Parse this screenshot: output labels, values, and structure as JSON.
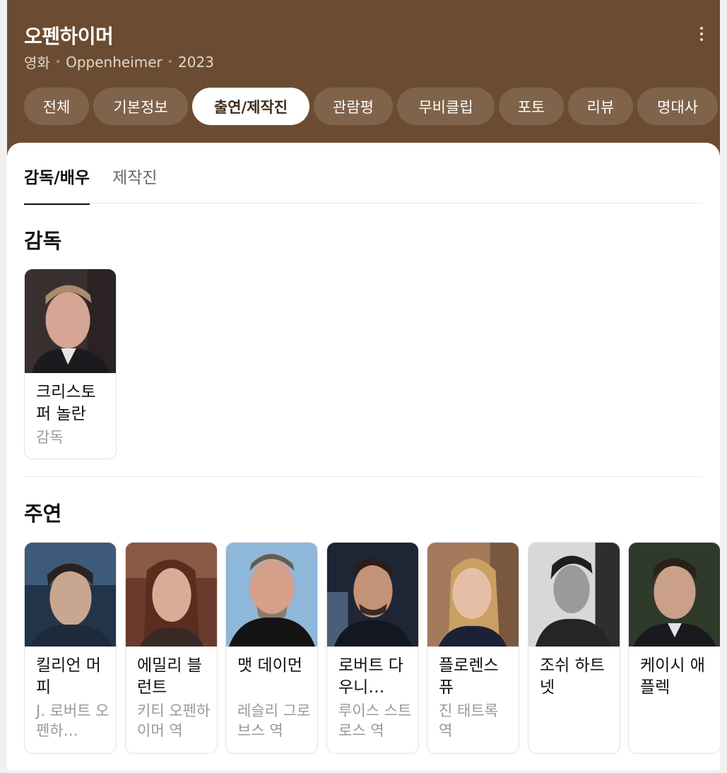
{
  "header": {
    "title": "오펜하이머",
    "subtitle": {
      "category": "영화",
      "original_title": "Oppenheimer",
      "year": "2023"
    },
    "more_icon": "vertical-ellipsis-icon"
  },
  "tabs": [
    {
      "label": "전체"
    },
    {
      "label": "기본정보"
    },
    {
      "label": "출연/제작진",
      "active": true
    },
    {
      "label": "관람평"
    },
    {
      "label": "무비클립"
    },
    {
      "label": "포토"
    },
    {
      "label": "리뷰"
    },
    {
      "label": "명대사"
    }
  ],
  "subtabs": [
    {
      "label": "감독/배우",
      "active": true
    },
    {
      "label": "제작진"
    }
  ],
  "directors": {
    "title": "감독",
    "people": [
      {
        "name": "크리스토퍼 놀란",
        "role": "감독"
      }
    ]
  },
  "cast": {
    "title": "주연",
    "people": [
      {
        "name": "킬리언 머피",
        "role": "J. 로버트 오펜하…"
      },
      {
        "name": "에밀리 블런트",
        "role": "키티 오펜하이머 역"
      },
      {
        "name": "맷 데이먼",
        "role": "레슬리 그로브스 역"
      },
      {
        "name": "로버트 다우니…",
        "role": "루이스 스트로스 역"
      },
      {
        "name": "플로렌스 퓨",
        "role": "진 태트록 역"
      },
      {
        "name": "조쉬 하트넷",
        "role": ""
      },
      {
        "name": "케이시 애플렉",
        "role": ""
      }
    ]
  },
  "colors": {
    "header_bg": "#6b4c32",
    "chip_bg": "#80634b",
    "active_chip_text": "#3e2b1c"
  }
}
